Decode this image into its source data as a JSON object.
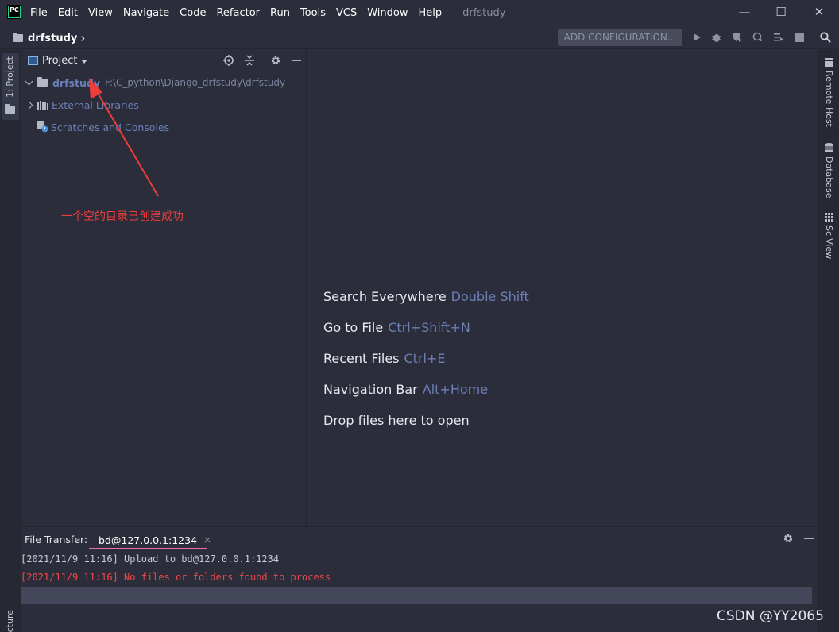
{
  "titlebar": {
    "app_logo": "PC",
    "menu": [
      {
        "label": "File",
        "mnemonic": "F",
        "rest": "ile"
      },
      {
        "label": "Edit",
        "mnemonic": "E",
        "rest": "dit"
      },
      {
        "label": "View",
        "mnemonic": "V",
        "rest": "iew"
      },
      {
        "label": "Navigate",
        "mnemonic": "N",
        "rest": "avigate"
      },
      {
        "label": "Code",
        "mnemonic": "C",
        "rest": "ode"
      },
      {
        "label": "Refactor",
        "mnemonic": "R",
        "rest": "efactor"
      },
      {
        "label": "Run",
        "mnemonic": "R",
        "rest": "un"
      },
      {
        "label": "Tools",
        "mnemonic": "T",
        "rest": "ools"
      },
      {
        "label": "VCS",
        "mnemonic": "V",
        "rest": "CS"
      },
      {
        "label": "Window",
        "mnemonic": "W",
        "rest": "indow"
      },
      {
        "label": "Help",
        "mnemonic": "H",
        "rest": "elp"
      }
    ],
    "window_title": "drfstudy",
    "minimize": "—",
    "maximize": "☐",
    "close": "✕"
  },
  "navbar": {
    "breadcrumb": "drfstudy",
    "chevron": "›",
    "add_configuration": "ADD CONFIGURATION...",
    "icons": [
      "run-icon",
      "debug-icon",
      "coverage-icon",
      "profile-icon",
      "run-list-icon",
      "stop-icon",
      "search-icon"
    ]
  },
  "left_strip": {
    "project_tab": "1: Project",
    "structure_tab": "cture"
  },
  "right_strip": {
    "remote_host": "Remote Host",
    "database": "Database",
    "sciview": "SciView"
  },
  "project_panel": {
    "title": "Project",
    "tree": [
      {
        "name": "drfstudy",
        "path": "F:\\C_python\\Django_drfstudy\\drfstudy",
        "expanded": true
      },
      {
        "name": "External Libraries",
        "expanded": false
      },
      {
        "name": "Scratches and Consoles"
      }
    ]
  },
  "annotation": {
    "text": "一个空的目录已创建成功",
    "color": "#f03c3c"
  },
  "editor": {
    "hints": [
      {
        "label": "Search Everywhere",
        "key": "Double Shift"
      },
      {
        "label": "Go to File",
        "key": "Ctrl+Shift+N"
      },
      {
        "label": "Recent Files",
        "key": "Ctrl+E"
      },
      {
        "label": "Navigation Bar",
        "key": "Alt+Home"
      },
      {
        "label": "Drop files here to open",
        "key": ""
      }
    ]
  },
  "bottom_panel": {
    "label": "File Transfer:",
    "tab": "bd@127.0.0.1:1234",
    "tab_close": "×",
    "logs": [
      {
        "text": "[2021/11/9 11:16] Upload to bd@127.0.0.1:1234",
        "color": "#c8cad4"
      },
      {
        "text": "[2021/11/9 11:16] No files or folders found to process",
        "color": "#f04848"
      }
    ]
  },
  "watermark": "CSDN @YY2065"
}
